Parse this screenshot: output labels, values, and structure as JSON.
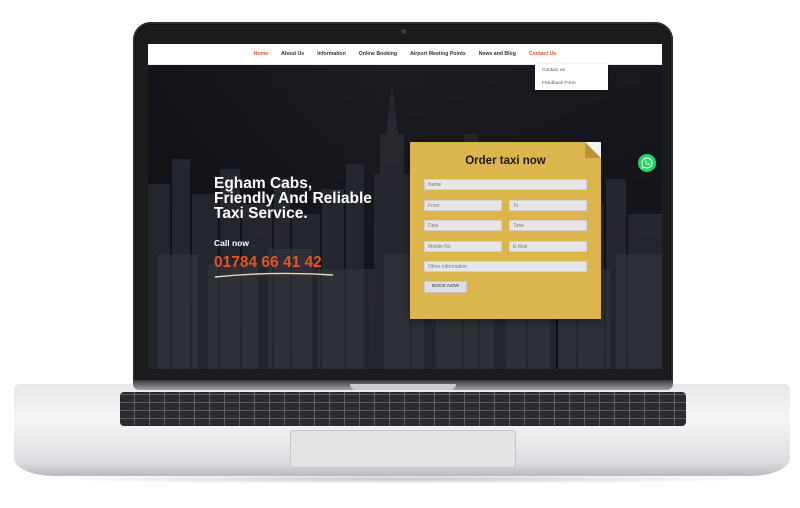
{
  "nav": {
    "items": [
      {
        "label": "Home",
        "state": "active"
      },
      {
        "label": "About Us",
        "state": "normal"
      },
      {
        "label": "Information",
        "state": "normal"
      },
      {
        "label": "Online Booking",
        "state": "normal"
      },
      {
        "label": "Airport Meeting Points",
        "state": "normal"
      },
      {
        "label": "News and Blog",
        "state": "normal"
      },
      {
        "label": "Contact Us",
        "state": "current"
      }
    ],
    "dropdown": [
      "Contact us",
      "Feedback Form"
    ]
  },
  "hero": {
    "title_line1": "Egham Cabs,",
    "title_line2": "Friendly And Reliable",
    "title_line3": "Taxi Service.",
    "call_label": "Call now",
    "phone": "01784 66 41 42"
  },
  "order_form": {
    "title": "Order taxi now",
    "name_placeholder": "Name",
    "from_placeholder": "From",
    "to_placeholder": "To",
    "date_placeholder": "Date",
    "time_placeholder": "Time",
    "mobile_placeholder": "Mobile No",
    "email_placeholder": "E-Mail",
    "other_placeholder": "Other information",
    "submit_label": "BOOK NOW"
  },
  "colors": {
    "accent": "#e2542a",
    "card": "#dcb54c",
    "whatsapp": "#25d366",
    "nav_bg": "#ffffff"
  },
  "icons": {
    "chat": "whatsapp-icon",
    "camera": "camera-icon"
  }
}
